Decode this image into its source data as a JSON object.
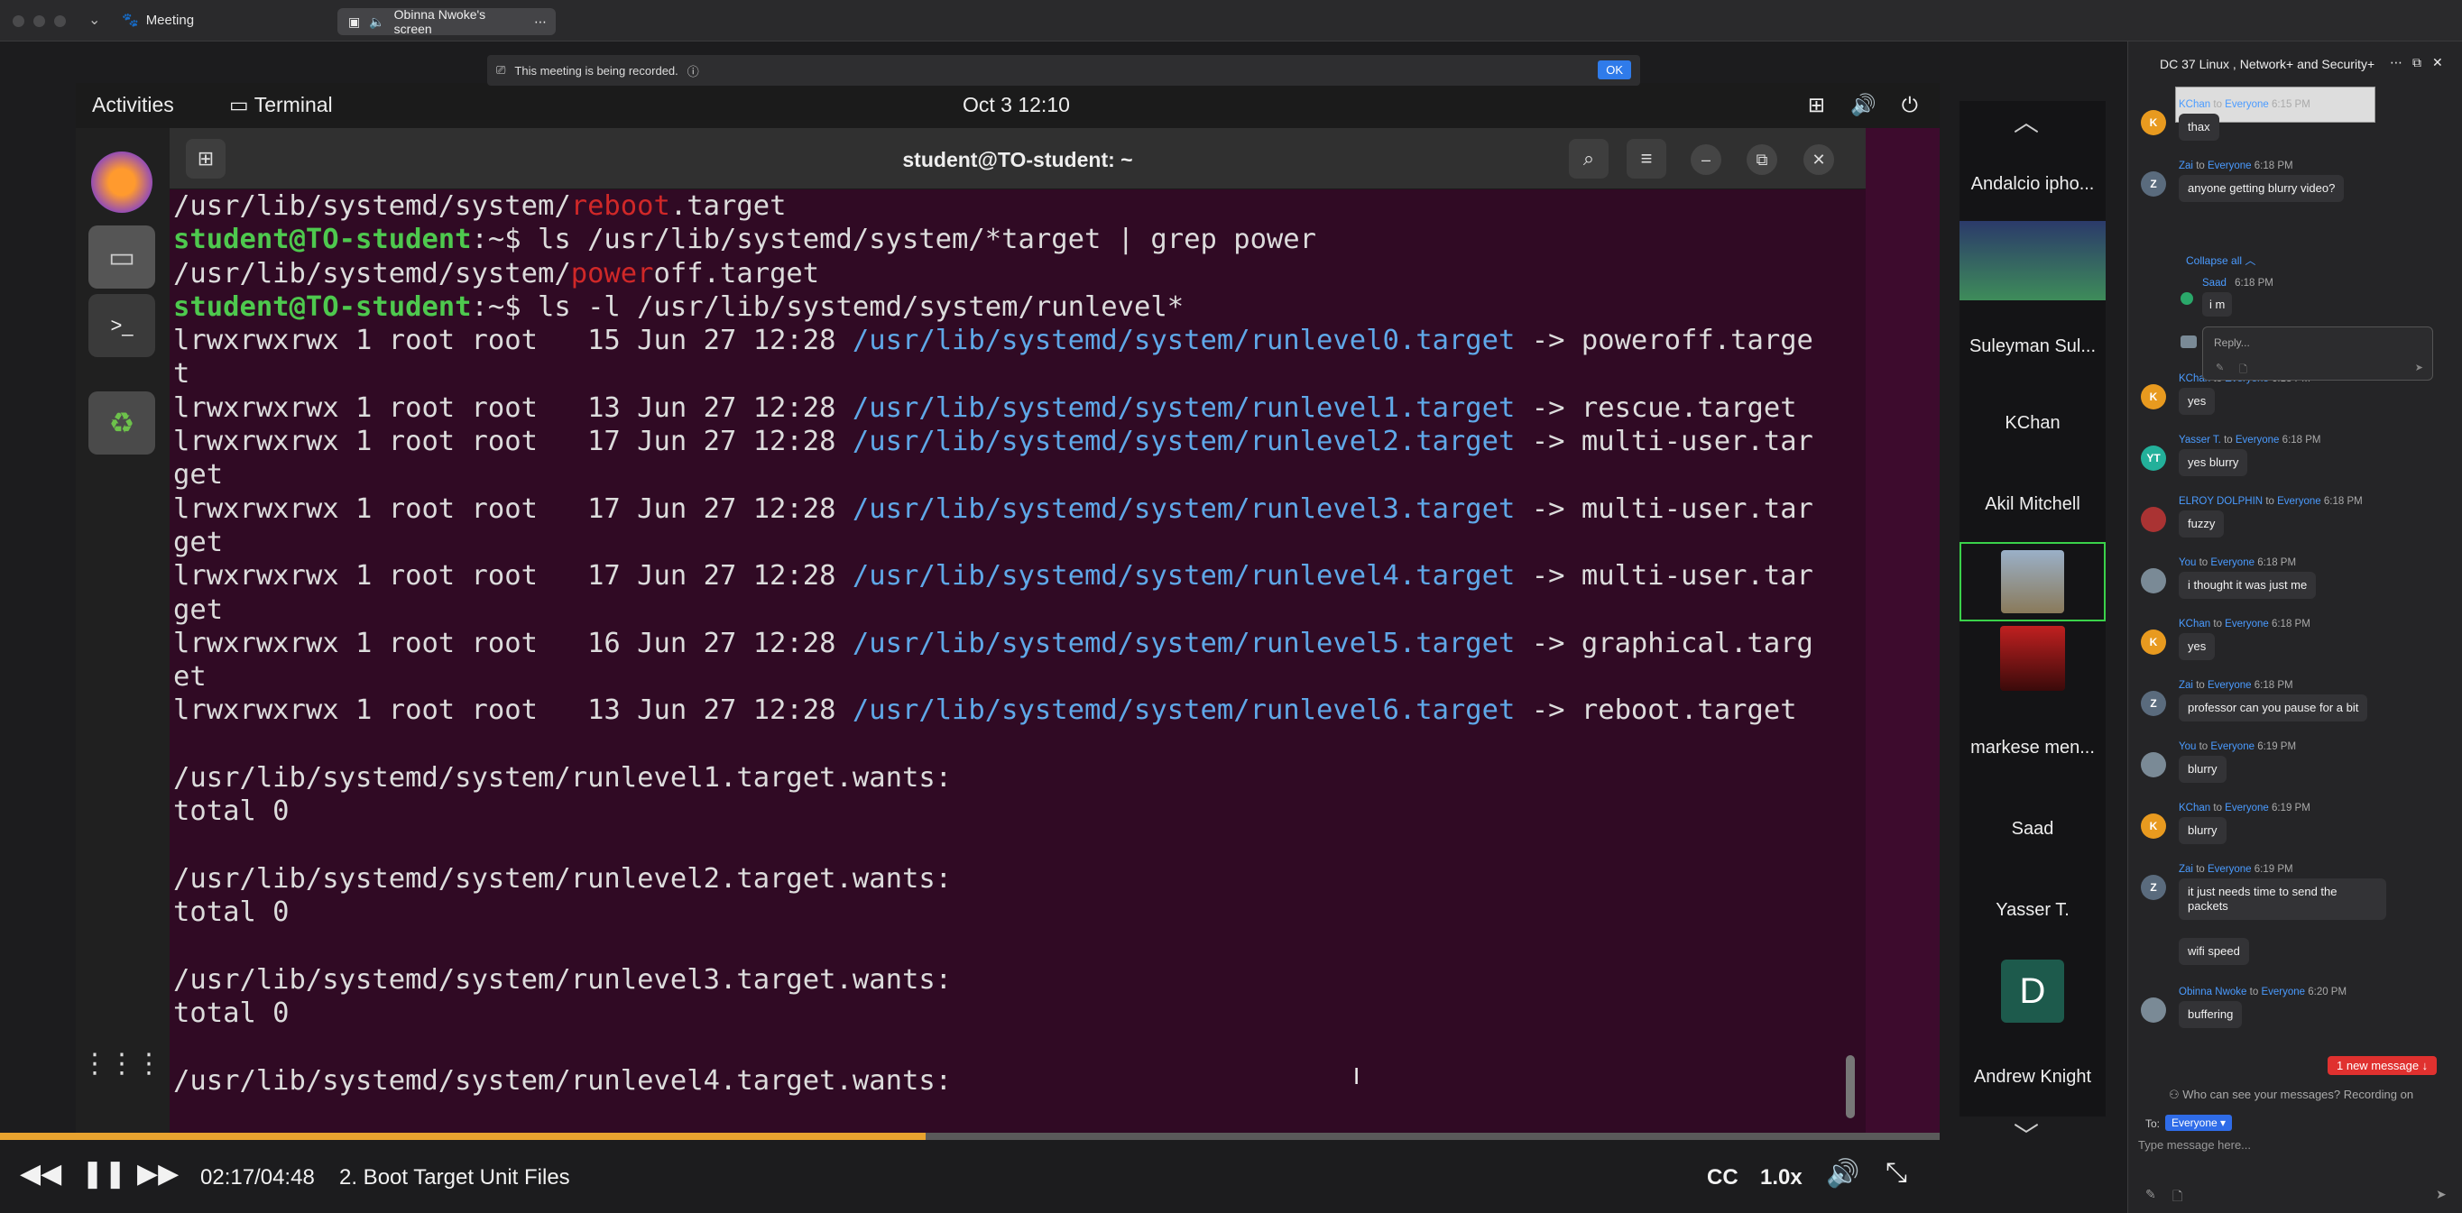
{
  "titlebar": {
    "meeting_label": "Meeting",
    "screen_label": "Obinna Nwoke's screen"
  },
  "recording": {
    "text": "This meeting is being recorded.",
    "ok_label": "OK"
  },
  "ubuntu": {
    "activities": "Activities",
    "app_name": "Terminal",
    "clock": "Oct 3  12:10",
    "window_title": "student@TO-student: ~"
  },
  "terminal_lines": [
    [
      {
        "t": "/usr/lib/systemd/system/"
      },
      {
        "t": "reboot",
        "c": "r"
      },
      {
        "t": ".target"
      }
    ],
    [
      {
        "t": "student@TO-student",
        "c": "g"
      },
      {
        "t": ":~$ ls /usr/lib/systemd/system/*target | grep power"
      }
    ],
    [
      {
        "t": "/usr/lib/systemd/system/"
      },
      {
        "t": "power",
        "c": "r"
      },
      {
        "t": "off.target"
      }
    ],
    [
      {
        "t": "student@TO-student",
        "c": "g"
      },
      {
        "t": ":~$ ls -l /usr/lib/systemd/system/runlevel*"
      }
    ],
    [
      {
        "t": "lrwxrwxrwx 1 root root   15 Jun 27 12:28 "
      },
      {
        "t": "/usr/lib/systemd/system/runlevel0.target",
        "c": "b"
      },
      {
        "t": " -> poweroff.targe"
      }
    ],
    [
      {
        "t": "t"
      }
    ],
    [
      {
        "t": "lrwxrwxrwx 1 root root   13 Jun 27 12:28 "
      },
      {
        "t": "/usr/lib/systemd/system/runlevel1.target",
        "c": "b"
      },
      {
        "t": " -> rescue.target"
      }
    ],
    [
      {
        "t": "lrwxrwxrwx 1 root root   17 Jun 27 12:28 "
      },
      {
        "t": "/usr/lib/systemd/system/runlevel2.target",
        "c": "b"
      },
      {
        "t": " -> multi-user.tar"
      }
    ],
    [
      {
        "t": "get"
      }
    ],
    [
      {
        "t": "lrwxrwxrwx 1 root root   17 Jun 27 12:28 "
      },
      {
        "t": "/usr/lib/systemd/system/runlevel3.target",
        "c": "b"
      },
      {
        "t": " -> multi-user.tar"
      }
    ],
    [
      {
        "t": "get"
      }
    ],
    [
      {
        "t": "lrwxrwxrwx 1 root root   17 Jun 27 12:28 "
      },
      {
        "t": "/usr/lib/systemd/system/runlevel4.target",
        "c": "b"
      },
      {
        "t": " -> multi-user.tar"
      }
    ],
    [
      {
        "t": "get"
      }
    ],
    [
      {
        "t": "lrwxrwxrwx 1 root root   16 Jun 27 12:28 "
      },
      {
        "t": "/usr/lib/systemd/system/runlevel5.target",
        "c": "b"
      },
      {
        "t": " -> graphical.targ"
      }
    ],
    [
      {
        "t": "et"
      }
    ],
    [
      {
        "t": "lrwxrwxrwx 1 root root   13 Jun 27 12:28 "
      },
      {
        "t": "/usr/lib/systemd/system/runlevel6.target",
        "c": "b"
      },
      {
        "t": " -> reboot.target"
      }
    ],
    [
      {
        "t": ""
      }
    ],
    [
      {
        "t": "/usr/lib/systemd/system/runlevel1.target.wants:"
      }
    ],
    [
      {
        "t": "total 0"
      }
    ],
    [
      {
        "t": ""
      }
    ],
    [
      {
        "t": "/usr/lib/systemd/system/runlevel2.target.wants:"
      }
    ],
    [
      {
        "t": "total 0"
      }
    ],
    [
      {
        "t": ""
      }
    ],
    [
      {
        "t": "/usr/lib/systemd/system/runlevel3.target.wants:"
      }
    ],
    [
      {
        "t": "total 0"
      }
    ],
    [
      {
        "t": ""
      }
    ],
    [
      {
        "t": "/usr/lib/systemd/system/runlevel4.target.wants:"
      }
    ]
  ],
  "player": {
    "time": "02:17/04:48",
    "chapter": "2. Boot Target Unit Files",
    "cc": "CC",
    "speed": "1.0x",
    "progress_fraction": 0.477
  },
  "gallery": [
    {
      "label": "Andalcio ipho...",
      "kind": "name"
    },
    {
      "label": "",
      "kind": "avatar-cartoon"
    },
    {
      "label": "Suleyman Sul...",
      "kind": "name"
    },
    {
      "label": "KChan",
      "kind": "name"
    },
    {
      "label": "Akil Mitchell",
      "kind": "name"
    },
    {
      "label": "",
      "kind": "video-highlight"
    },
    {
      "label": "",
      "kind": "video-red"
    },
    {
      "label": "markese men...",
      "kind": "name"
    },
    {
      "label": "Saad",
      "kind": "name"
    },
    {
      "label": "Yasser T.",
      "kind": "name"
    },
    {
      "label": "D",
      "kind": "initial"
    },
    {
      "label": "Andrew Knight",
      "kind": "name"
    }
  ],
  "chat": {
    "title": "DC 37 Linux , Network+ and Security+",
    "messages": [
      {
        "sender": "KChan",
        "to": "Everyone",
        "time": "6:15 PM",
        "text": "thax",
        "av": "K",
        "avc": "#e89a1f"
      },
      {
        "sender": "Zai",
        "to": "Everyone",
        "time": "6:18 PM",
        "text": "anyone getting blurry video?",
        "av": "Z",
        "avc": "#5a6b7d"
      },
      {
        "sender": "KChan",
        "to": "Everyone",
        "time": "6:18 PM",
        "text": "yes",
        "av": "K",
        "avc": "#e89a1f"
      },
      {
        "sender": "Yasser T.",
        "to": "Everyone",
        "time": "6:18 PM",
        "text": "yes blurry",
        "av": "YT",
        "avc": "#23b09a"
      },
      {
        "sender": "ELROY DOLPHIN",
        "to": "Everyone",
        "time": "6:18 PM",
        "text": "fuzzy",
        "av": "",
        "avc": "#a33"
      },
      {
        "sender": "You",
        "to": "Everyone",
        "time": "6:18 PM",
        "text": "i thought it was just me",
        "av": "",
        "avc": "#7a8a96"
      },
      {
        "sender": "KChan",
        "to": "Everyone",
        "time": "6:18 PM",
        "text": "yes",
        "av": "K",
        "avc": "#e89a1f"
      },
      {
        "sender": "Zai",
        "to": "Everyone",
        "time": "6:18 PM",
        "text": "professor can you pause for a bit",
        "av": "Z",
        "avc": "#5a6b7d"
      },
      {
        "sender": "You",
        "to": "Everyone",
        "time": "6:19 PM",
        "text": "blurry",
        "av": "",
        "avc": "#7a8a96"
      },
      {
        "sender": "KChan",
        "to": "Everyone",
        "time": "6:19 PM",
        "text": "blurry",
        "av": "K",
        "avc": "#e89a1f"
      },
      {
        "sender": "Zai",
        "to": "Everyone",
        "time": "6:19 PM",
        "text": "it just needs time to send the packets",
        "av": "Z",
        "avc": "#5a6b7d"
      },
      {
        "sender": "",
        "to": "",
        "time": "",
        "text": "wifi speed",
        "av": "",
        "avc": ""
      },
      {
        "sender": "Obinna Nwoke",
        "to": "Everyone",
        "time": "6:20 PM",
        "text": "buffering",
        "av": "",
        "avc": "#7a8a96"
      }
    ],
    "thread": {
      "collapse_label": "Collapse all",
      "reply_sender": "Saad",
      "reply_time": "6:18 PM",
      "reply_text": "i m",
      "reply_placeholder": "Reply..."
    },
    "to_word": "to",
    "new_message": "1 new message",
    "privacy_note": "Who can see your messages? Recording on",
    "to_label": "To:",
    "recipient": "Everyone",
    "input_placeholder": "Type message here..."
  }
}
